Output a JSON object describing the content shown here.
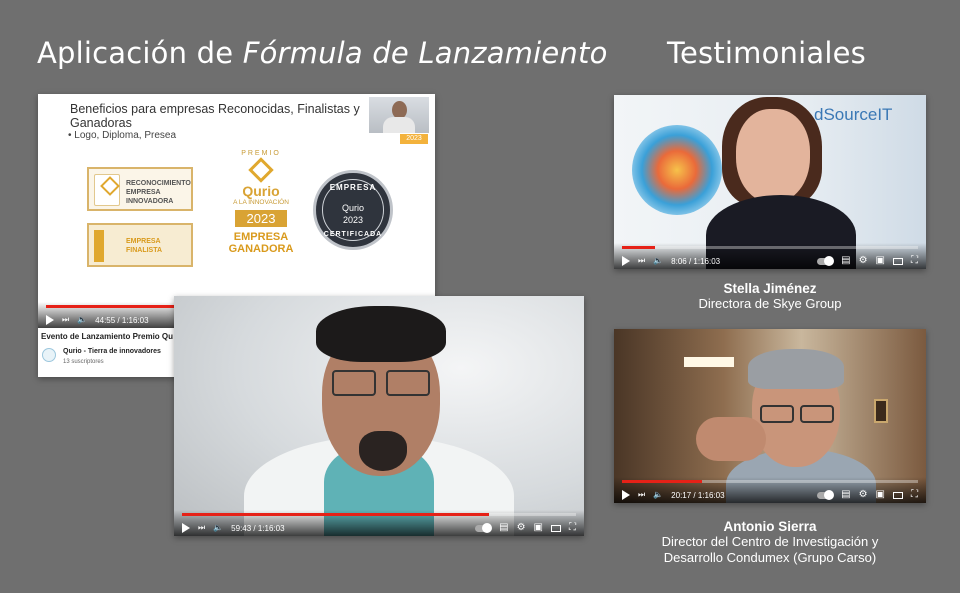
{
  "headings": {
    "left_prefix": "Aplicación de ",
    "left_emphasis": "Fórmula de Lanzamiento",
    "right": "Testimoniales"
  },
  "slide_video": {
    "slide_title": "Beneficios para empresas Reconocidas, Finalistas y Ganadoras",
    "slide_bullet": "• Logo, Diploma, Presea",
    "award_reconocimiento": "RECONOCIMIENTO EMPRESA INNOVADORA",
    "award_finalista": "EMPRESA FINALISTA",
    "premio": {
      "label": "PREMIO",
      "brand": "Qurio",
      "sub": "A LA INNOVACIÓN",
      "year": "2023",
      "ganadora": "EMPRESA GANADORA"
    },
    "seal": {
      "top": "EMPRESA",
      "brand": "Qurio",
      "year": "2023",
      "bottom": "CERTIFICADA"
    },
    "time": "44:55 / 1:16:03",
    "progress_fraction": 0.59,
    "event_title": "Evento de Lanzamiento Premio Qu",
    "channel_name": "Qurio - Tierra de innovadores",
    "channel_subs": "13 suscriptores"
  },
  "main_video": {
    "time": "59:43 / 1:16:03",
    "progress_fraction": 0.78
  },
  "testimonials": [
    {
      "name": "Stella Jiménez",
      "role": "Directora de Skye Group",
      "time": "8:06 / 1:16:03",
      "progress_fraction": 0.11,
      "backdrop_text": "dSourceIT"
    },
    {
      "name": "Antonio Sierra",
      "role_line1": "Director del Centro de Investigación y",
      "role_line2": "Desarrollo Condumex (Grupo Carso)",
      "time": "20:17 / 1:16:03",
      "progress_fraction": 0.27
    }
  ],
  "icons": [
    "play-icon",
    "next-icon",
    "volume-icon",
    "autoplay-toggle-icon",
    "subtitles-icon",
    "settings-icon",
    "miniplayer-icon",
    "theater-icon",
    "fullscreen-icon"
  ],
  "colors": {
    "background": "#6f6f6f",
    "progress": "#e62117",
    "gold": "#d9a334"
  }
}
